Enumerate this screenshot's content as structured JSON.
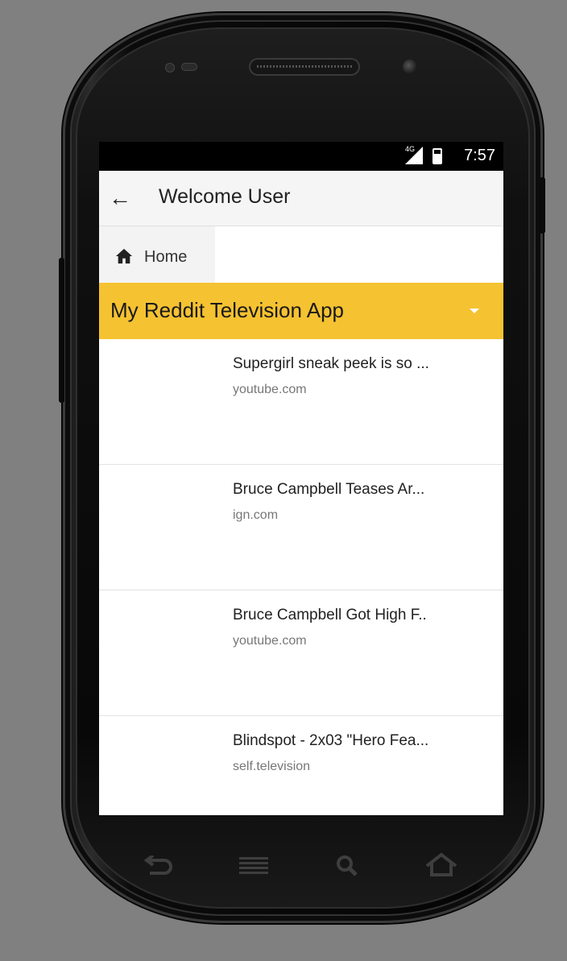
{
  "status_bar": {
    "network": "4G",
    "time": "7:57"
  },
  "app_bar": {
    "back_icon": "arrow-left-icon",
    "title": "Welcome User"
  },
  "tabs": [
    {
      "icon": "home-icon",
      "label": "Home"
    }
  ],
  "subreddit_bar": {
    "title": "My Reddit Television App",
    "dropdown_icon": "caret-down-icon",
    "color": "#f5c231"
  },
  "posts": [
    {
      "title": "Supergirl sneak peek is so ...",
      "domain": "youtube.com"
    },
    {
      "title": "Bruce Campbell Teases Ar...",
      "domain": "ign.com"
    },
    {
      "title": "Bruce Campbell Got High F..",
      "domain": "youtube.com"
    },
    {
      "title": "Blindspot - 2x03 \"Hero Fea...",
      "domain": "self.television"
    }
  ],
  "hardware_keys": [
    "back-key-icon",
    "menu-key-icon",
    "search-key-icon",
    "home-key-icon"
  ]
}
